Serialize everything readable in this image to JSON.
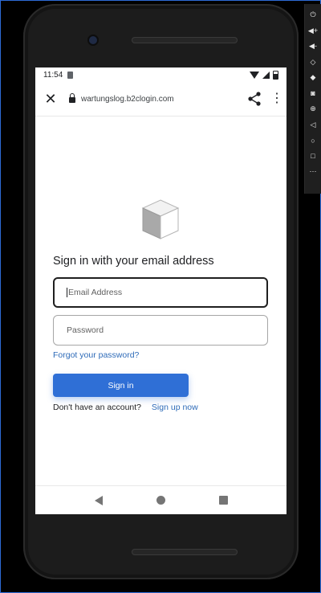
{
  "status_bar": {
    "time": "11:54"
  },
  "browser": {
    "url": "wartungslog.b2clogin.com"
  },
  "signin": {
    "heading": "Sign in with your email address",
    "email_placeholder": "Email Address",
    "password_placeholder": "Password",
    "forgot_label": "Forgot your password?",
    "signin_label": "Sign in",
    "no_account_text": "Don't have an account?",
    "signup_label": "Sign up now"
  },
  "emulator_toolbar": {
    "tools": [
      "power-icon",
      "volume-up-icon",
      "volume-down-icon",
      "rotate-left-icon",
      "rotate-right-icon",
      "camera-icon",
      "zoom-icon",
      "back-icon",
      "home-icon",
      "overview-icon",
      "more-icon"
    ]
  },
  "colors": {
    "accent": "#2f6fd6",
    "link": "#2e6bb8",
    "frame_border": "#2d6bd6"
  }
}
